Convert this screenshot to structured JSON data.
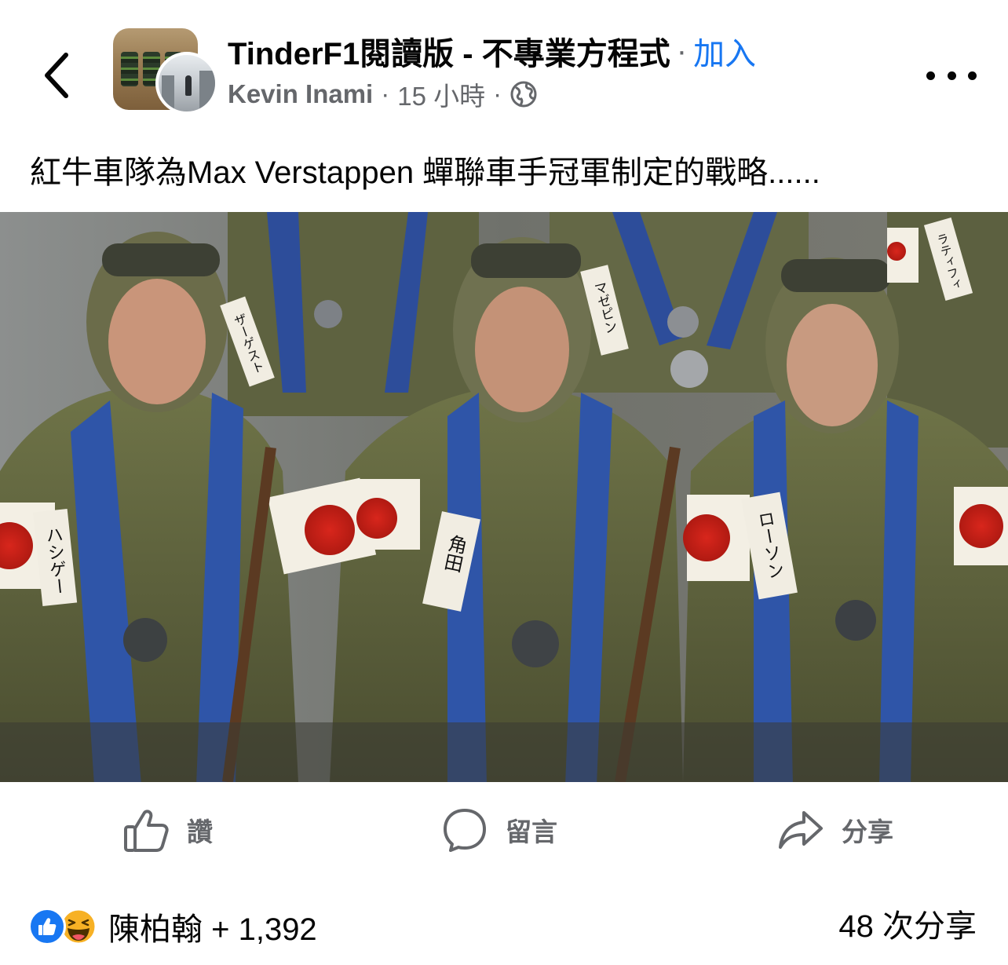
{
  "header": {
    "group_name": "TinderF1閱讀版 - 不專業方程式",
    "separator": "·",
    "join_label": "加入",
    "author": "Kevin Inami",
    "time": "15 小時",
    "visibility_icon": "globe-icon"
  },
  "post": {
    "caption": "紅牛車隊為Max Verstappen 蟬聯車手冠軍制定的戰略......",
    "photo_tags": [
      "ハシゲー",
      "角田",
      "ローソン",
      "マゼピン",
      "ザーゲスト",
      "ラティフィ"
    ]
  },
  "actions": {
    "like_label": "讚",
    "comment_label": "留言",
    "share_label": "分享"
  },
  "footer": {
    "reactions_text": "陳柏翰 + 1,392",
    "shares_text": "48 次分享"
  },
  "colors": {
    "accent": "#1877f2",
    "secondary_text": "#65676b",
    "primary_text": "#050505"
  }
}
